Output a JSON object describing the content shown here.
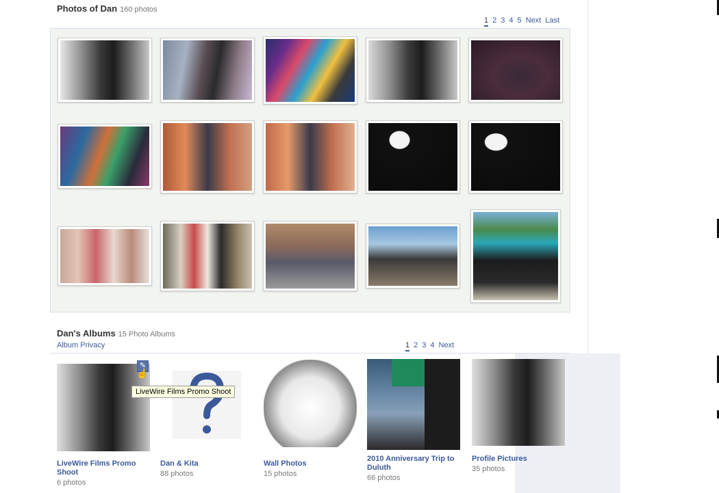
{
  "photos_section": {
    "title": "Photos of Dan",
    "count": "160 photos",
    "pager": [
      "1",
      "2",
      "3",
      "4",
      "5",
      "Next",
      "Last"
    ]
  },
  "albums_section": {
    "title": "Dan's Albums",
    "count": "15 Photo Albums",
    "privacy_link": "Album Privacy",
    "pager": [
      "1",
      "2",
      "3",
      "4",
      "Next"
    ],
    "albums": [
      {
        "name": "LiveWire Films Promo Shoot",
        "photos": "6 photos"
      },
      {
        "name": "Dan & Kita",
        "photos": "88 photos"
      },
      {
        "name": "Wall Photos",
        "photos": "15 photos"
      },
      {
        "name": "2010 Anniversary Trip to Duluth",
        "photos": "66 photos"
      },
      {
        "name": "Profile Pictures",
        "photos": "35 photos"
      }
    ],
    "tooltip": "LiveWire Films Promo Shoot"
  },
  "icons": {
    "edit": "pencil-icon",
    "cursor": "hand-cursor-icon",
    "question": "question-mark-icon"
  },
  "colors": {
    "link": "#3b5998",
    "panel": "#f2f4f0"
  }
}
